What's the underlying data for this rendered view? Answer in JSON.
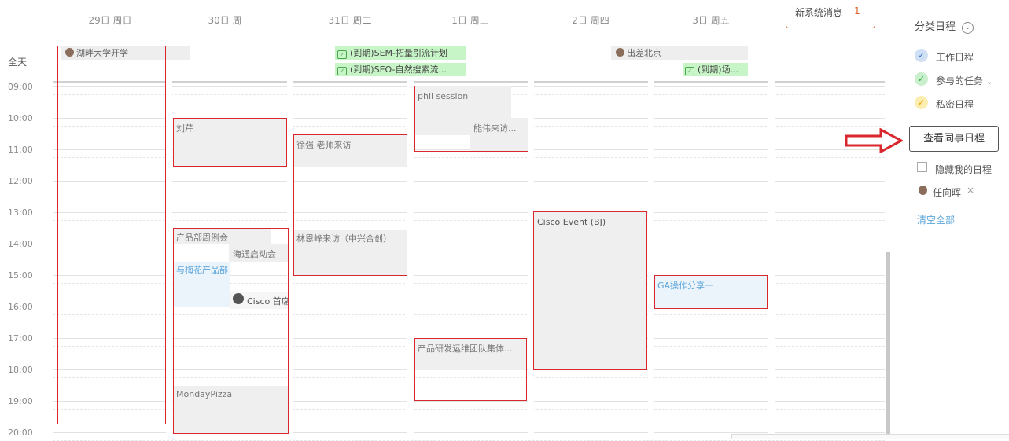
{
  "calendar": {
    "days": [
      "29日 周日",
      "30日 周一",
      "31日 周二",
      "1日 周三",
      "2日 周四",
      "3日 周五"
    ],
    "allday_label": "全天",
    "hours": [
      "09:00",
      "10:00",
      "11:00",
      "12:00",
      "13:00",
      "14:00",
      "15:00",
      "16:00",
      "17:00",
      "18:00",
      "19:00",
      "20:00"
    ],
    "allday_events": {
      "e1": "湖畔大学开学",
      "e2": "(到期)SEM-拓量引流计划",
      "e3": "(到期)SEO-自然搜索流...",
      "e4": "出差北京",
      "e5": "(到期)场..."
    },
    "events": {
      "sun_block": "",
      "liuqin": "刘芹",
      "product_weekly": "产品部周例会",
      "haitong": "海通启动会",
      "meihua": "与梅花产品部",
      "cisco_first": "Cisco 首席",
      "monday_pizza": "MondayPizza",
      "xuqiang": "徐强 老师来访",
      "linenfeng": "林恩峰来访（中兴合创）",
      "phil": "phil session",
      "nengwei": "能伟来访...",
      "team": "产品研发运维团队集体...",
      "cisco_event": "Cisco Event (BJ)",
      "ga": "GA操作分享一"
    }
  },
  "notification": {
    "label": "新系统消息",
    "count": "1"
  },
  "sidebar": {
    "title": "分类日程",
    "categories": {
      "work": "工作日程",
      "tasks": "参与的任务",
      "private": "私密日程"
    },
    "colleague_button": "查看同事日程",
    "hide_mine": "隐藏我的日程",
    "colleague_name": "任向晖",
    "clear_all": "清空全部"
  },
  "colors": {
    "highlight_border": "#d9272e",
    "arrow": "#d9272e",
    "allday_green": "#c8f5c8",
    "event_gray": "#efefef",
    "event_blue_bg": "#ebf3fb",
    "link_blue": "#5ba5d9",
    "work_check": "#2b6cc4",
    "task_check": "#2fa83a",
    "private_check": "#e6a400"
  },
  "icons": {
    "dropdown": "chevron-down-icon",
    "checkmark": "check-icon",
    "arrow": "right-arrow-icon",
    "remove": "close-icon",
    "avatar": "avatar-icon",
    "todo": "todo-check-icon"
  }
}
